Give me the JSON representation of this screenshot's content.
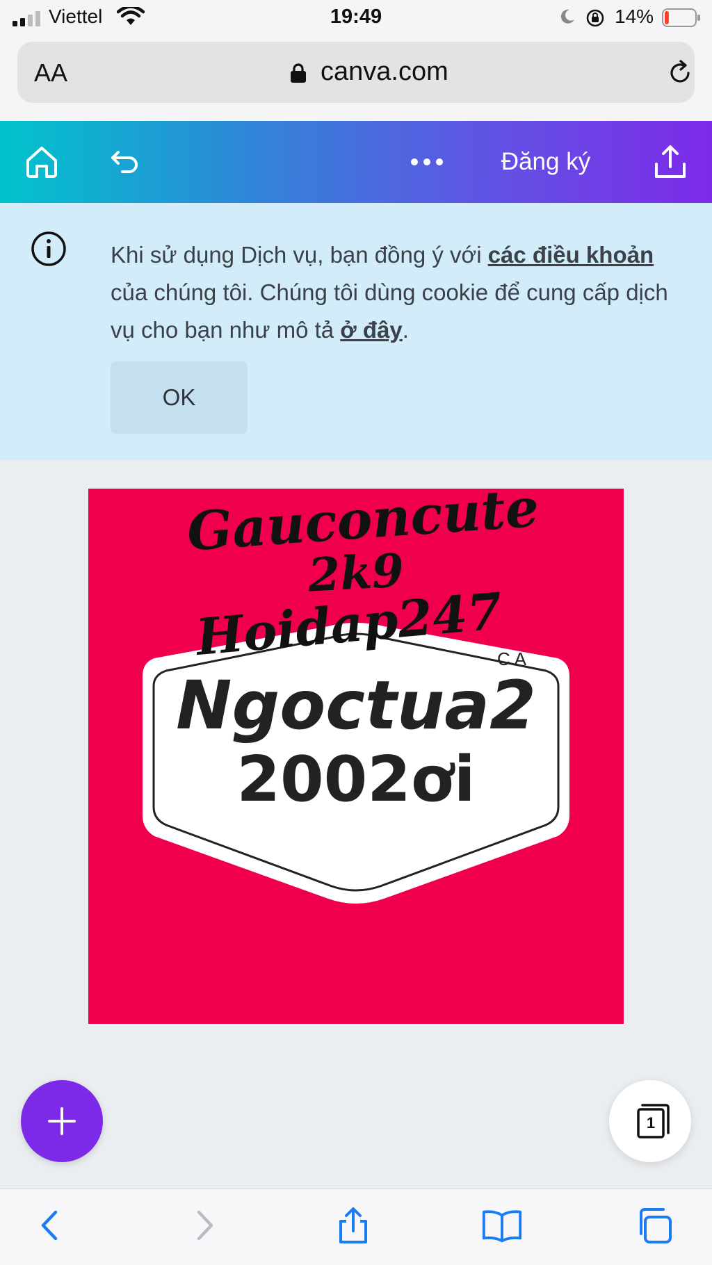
{
  "status_bar": {
    "carrier": "Viettel",
    "time": "19:49",
    "battery": "14%",
    "battery_level": 0.14
  },
  "browser": {
    "text_size_label": "AA",
    "domain": "canva.com"
  },
  "toolbar": {
    "signup_label": "Đăng ký"
  },
  "cookie_banner": {
    "text_part1": "Khi sử dụng Dịch vụ, bạn đồng ý với ",
    "terms_link": "các điều khoản",
    "text_part2": " của chúng tôi. Chúng tôi dùng cookie để cung cấp dịch vụ cho bạn như mô tả ",
    "here_link": "ở đây",
    "text_part3": ".",
    "ok_label": "OK"
  },
  "design": {
    "background_color": "#f0004c",
    "line1": "Gauconcute",
    "line2": "2k9",
    "line3": "Hoidap247",
    "corner_text": "C A",
    "badge_line1": "Ngoctua2",
    "badge_line2": "2002ơi"
  },
  "pages": {
    "count": "1"
  },
  "colors": {
    "toolbar_start": "#00c4cc",
    "toolbar_end": "#7d2ae8",
    "add_button": "#7d2ae8",
    "banner_bg": "#d3ecf9",
    "safari_blue": "#1a7cf5"
  }
}
